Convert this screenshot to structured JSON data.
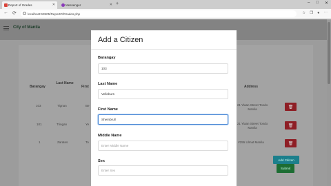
{
  "browser": {
    "tabs": [
      {
        "label": "Report of Grades",
        "favicon_color": "#d9443a"
      },
      {
        "label": "Messenger",
        "favicon_color": "#8a3ab9"
      }
    ],
    "new_tab": "+",
    "url": "localhost:63505/ReportOfGrades.php",
    "window_controls": [
      "–",
      "□",
      "✕"
    ]
  },
  "app": {
    "brand": "City of Manila"
  },
  "table": {
    "headers": [
      "Barangay",
      "Last Name",
      "First",
      "Address"
    ],
    "rows": [
      {
        "barangay": "103",
        "last": "Tignan",
        "first": "Be",
        "address": "21 Ylaan Street Tondo Manila"
      },
      {
        "barangay": "101",
        "last": "Tringan",
        "first": "Ye",
        "address": "21 Ylaan Street Tondo Manila"
      },
      {
        "barangay": "1",
        "last": "Zarates",
        "first": "To",
        "address": "#255 Ulmat Manila"
      }
    ],
    "delete_glyph": "🗑"
  },
  "buttons": {
    "add": "Add Citizen",
    "submit": "Submit"
  },
  "modal": {
    "title": "Add a Citizen",
    "fields": {
      "barangay": {
        "label": "Barangay",
        "value": "103"
      },
      "last_name": {
        "label": "Last Name",
        "value": "Velleburs"
      },
      "first_name": {
        "label": "First Name",
        "value": "Shembrull"
      },
      "middle_name": {
        "label": "Middle Name",
        "placeholder": "Enter Middle Name"
      },
      "sex": {
        "label": "Sex",
        "placeholder": "Enter Sex"
      }
    }
  },
  "colors": {
    "overlay": "#9c9c9c",
    "danger": "#8e1e25",
    "info": "#1c7f8c",
    "success": "#1d6d33",
    "focus": "#4f8bd6"
  }
}
